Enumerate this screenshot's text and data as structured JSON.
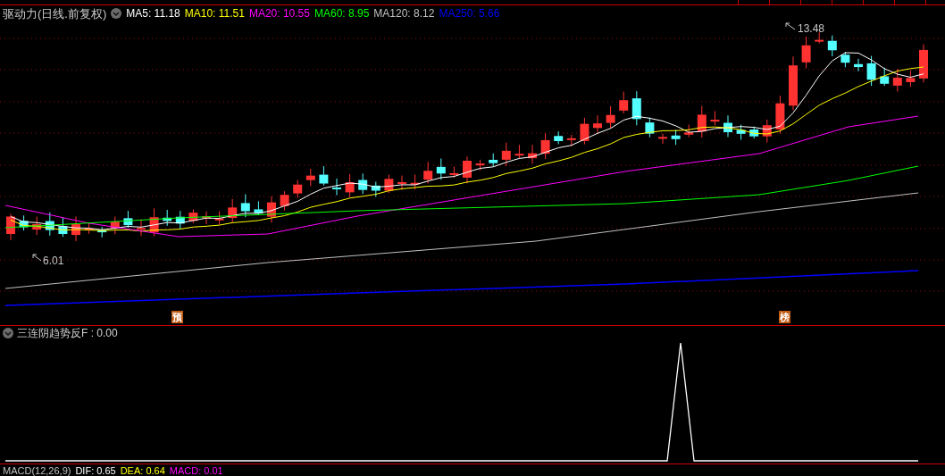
{
  "chart_header": {
    "title": "驱动力(日线.前复权)",
    "ma_legend": [
      {
        "label": "MA5: 11.18",
        "color": "#ffffff"
      },
      {
        "label": "MA10: 11.51",
        "color": "#ffff00"
      },
      {
        "label": "MA20: 10.55",
        "color": "#ff00ff"
      },
      {
        "label": "MA60: 8.95",
        "color": "#00ff00"
      },
      {
        "label": "MA120: 8.12",
        "color": "#c0c0c0"
      },
      {
        "label": "MA250: 5.66",
        "color": "#0000ff"
      }
    ]
  },
  "price_annotations": {
    "high": "13.48",
    "low": "6.01"
  },
  "event_markers": [
    {
      "label": "预"
    },
    {
      "label": "榜"
    }
  ],
  "indicator_panel": {
    "title": "三连阴趋势反F : 0.00"
  },
  "macd_legend": [
    {
      "label": "MACD(12,26,9)",
      "color": "#c0c0c0"
    },
    {
      "label": "DIF: 0.65",
      "color": "#ffffff"
    },
    {
      "label": "DEA: 0.64",
      "color": "#ffff00"
    },
    {
      "label": "MACD: 0.01",
      "color": "#ff00ff"
    }
  ]
}
